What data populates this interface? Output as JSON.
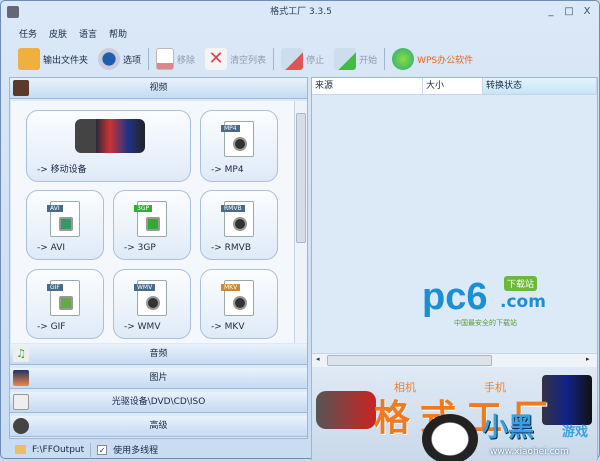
{
  "window": {
    "title": "格式工厂 3.3.5",
    "minimize": "_",
    "maximize": "□",
    "close": "X"
  },
  "menu": [
    "任务",
    "皮肤",
    "语言",
    "帮助"
  ],
  "toolbar": {
    "output_folder": "输出文件夹",
    "options": "选项",
    "remove": "移除",
    "clear_list": "清空列表",
    "stop": "停止",
    "start": "开始",
    "wps": "WPS办公软件",
    "wps_color": "#e8661c"
  },
  "left": {
    "video_header": "视频",
    "tiles": [
      {
        "label": "-> 移动设备"
      },
      {
        "label": "-> MP4",
        "badge": "MP4"
      },
      {
        "label": "-> AVI",
        "badge": "AVI"
      },
      {
        "label": "-> 3GP",
        "badge": "3GP"
      },
      {
        "label": "-> RMVB",
        "badge": "RMVB"
      },
      {
        "label": "-> GIF",
        "badge": "GIF"
      },
      {
        "label": "-> WMV",
        "badge": "WMV"
      },
      {
        "label": "-> MKV",
        "badge": "MKV"
      }
    ],
    "categories": [
      "音频",
      "图片",
      "光驱设备\\DVD\\CD\\ISO",
      "高级"
    ]
  },
  "status": {
    "output_path": "F:\\FFOutput",
    "multithread_label": "使用多线程",
    "multithread_checked": true
  },
  "list": {
    "columns": [
      "来源",
      "大小",
      "转换状态"
    ]
  },
  "watermark": {
    "pc6": "pc6",
    "pc6_badge": "下载站",
    "pc6_com": ".com",
    "pc6_sub": "中国最安全的下载站",
    "banner_title": "格式工厂",
    "banner_small1": "相机",
    "banner_small2": "手机",
    "xiaohei": "小黑",
    "xiaohei_sub": "游戏",
    "xiaohei_url": "www.xiaohei.com"
  }
}
